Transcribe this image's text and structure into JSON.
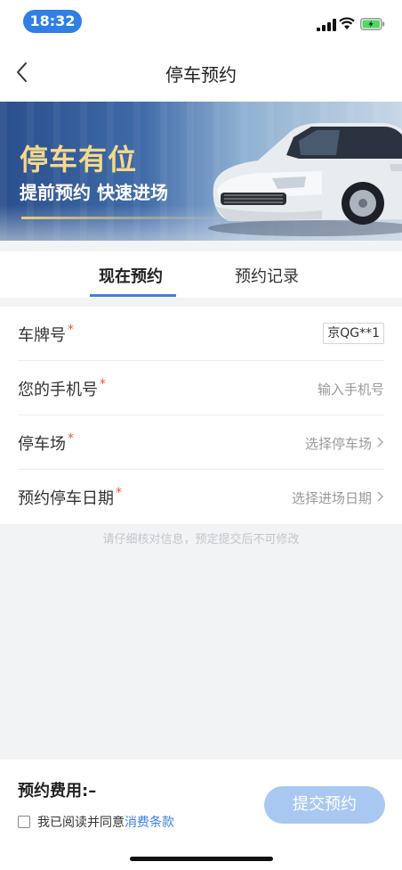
{
  "status_bar": {
    "time": "18:32"
  },
  "nav": {
    "title": "停车预约"
  },
  "banner": {
    "headline": "停车有位",
    "subline": "提前预约 快速进场"
  },
  "tabs": [
    {
      "label": "现在预约",
      "active": true
    },
    {
      "label": "预约记录",
      "active": false
    }
  ],
  "form": {
    "plate": {
      "label": "车牌号",
      "required_mark": "*",
      "value": "京QG**1"
    },
    "phone": {
      "label": "您的手机号",
      "required_mark": "*",
      "placeholder": "输入手机号"
    },
    "lot": {
      "label": "停车场",
      "required_mark": "*",
      "value": "选择停车场"
    },
    "date": {
      "label": "预约停车日期",
      "required_mark": "*",
      "value": "选择进场日期"
    }
  },
  "notice": "请仔细核对信息，预定提交后不可修改",
  "footer": {
    "fee_text": "预约费用:–",
    "agree_text": "我已阅读并同意",
    "agree_link": "消费条款",
    "submit_label": "提交预约"
  },
  "colors": {
    "accent": "#3e7fe0",
    "submit_disabled": "#a8c8f2",
    "required": "#e8553f",
    "time_pill": "#2f7fe6",
    "banner_headline": "#f5d98a"
  },
  "icons": [
    "signal-icon",
    "wifi-icon",
    "battery-icon",
    "back-arrow-icon",
    "chevron-right-icon"
  ]
}
